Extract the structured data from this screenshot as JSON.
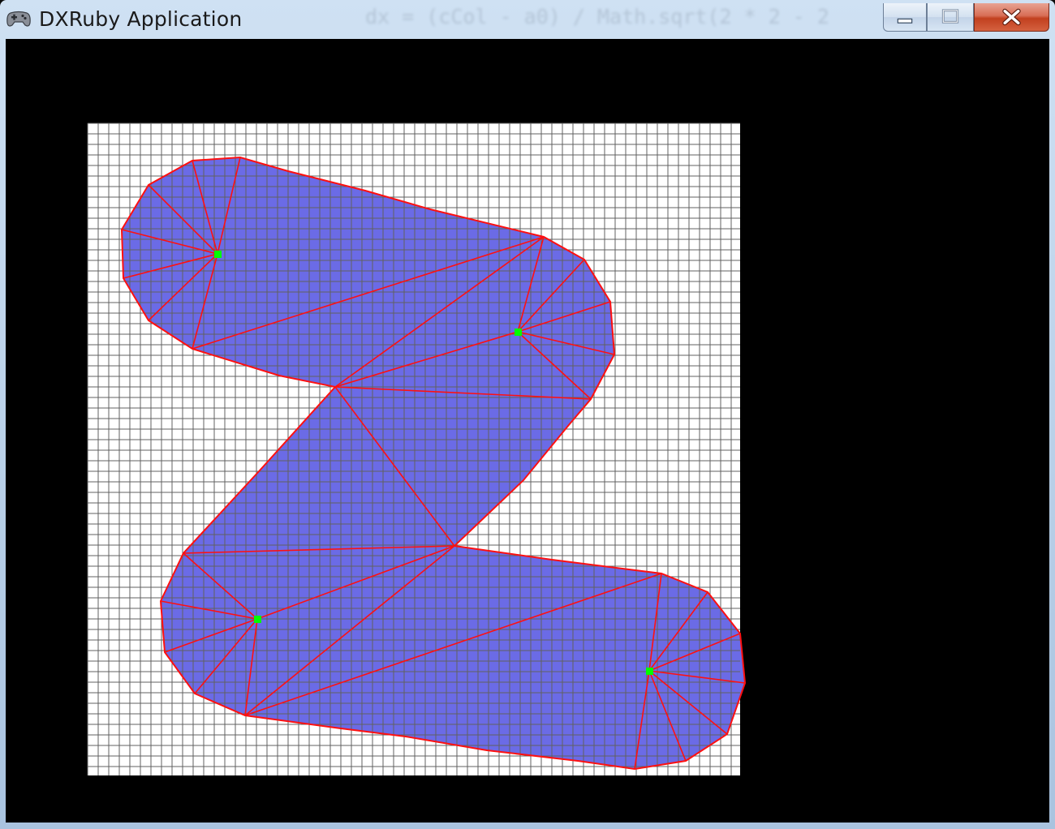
{
  "window": {
    "title": "DXRuby Application",
    "background_title_text": "dx = (cCol - a0) / Math.sqrt(2 * 2 - 2"
  },
  "icons": {
    "app": "gamepad-icon",
    "minimize": "minimize-icon",
    "maximize": "maximize-icon",
    "close": "close-icon"
  },
  "colors": {
    "background": "#000000",
    "grid_fill": "#ffffff",
    "grid_line": "#606060",
    "shape_fill": "#6b6be6",
    "triangle_edge": "#ff1010",
    "center_point": "#00ff00",
    "close_button": "#c9462a"
  }
}
